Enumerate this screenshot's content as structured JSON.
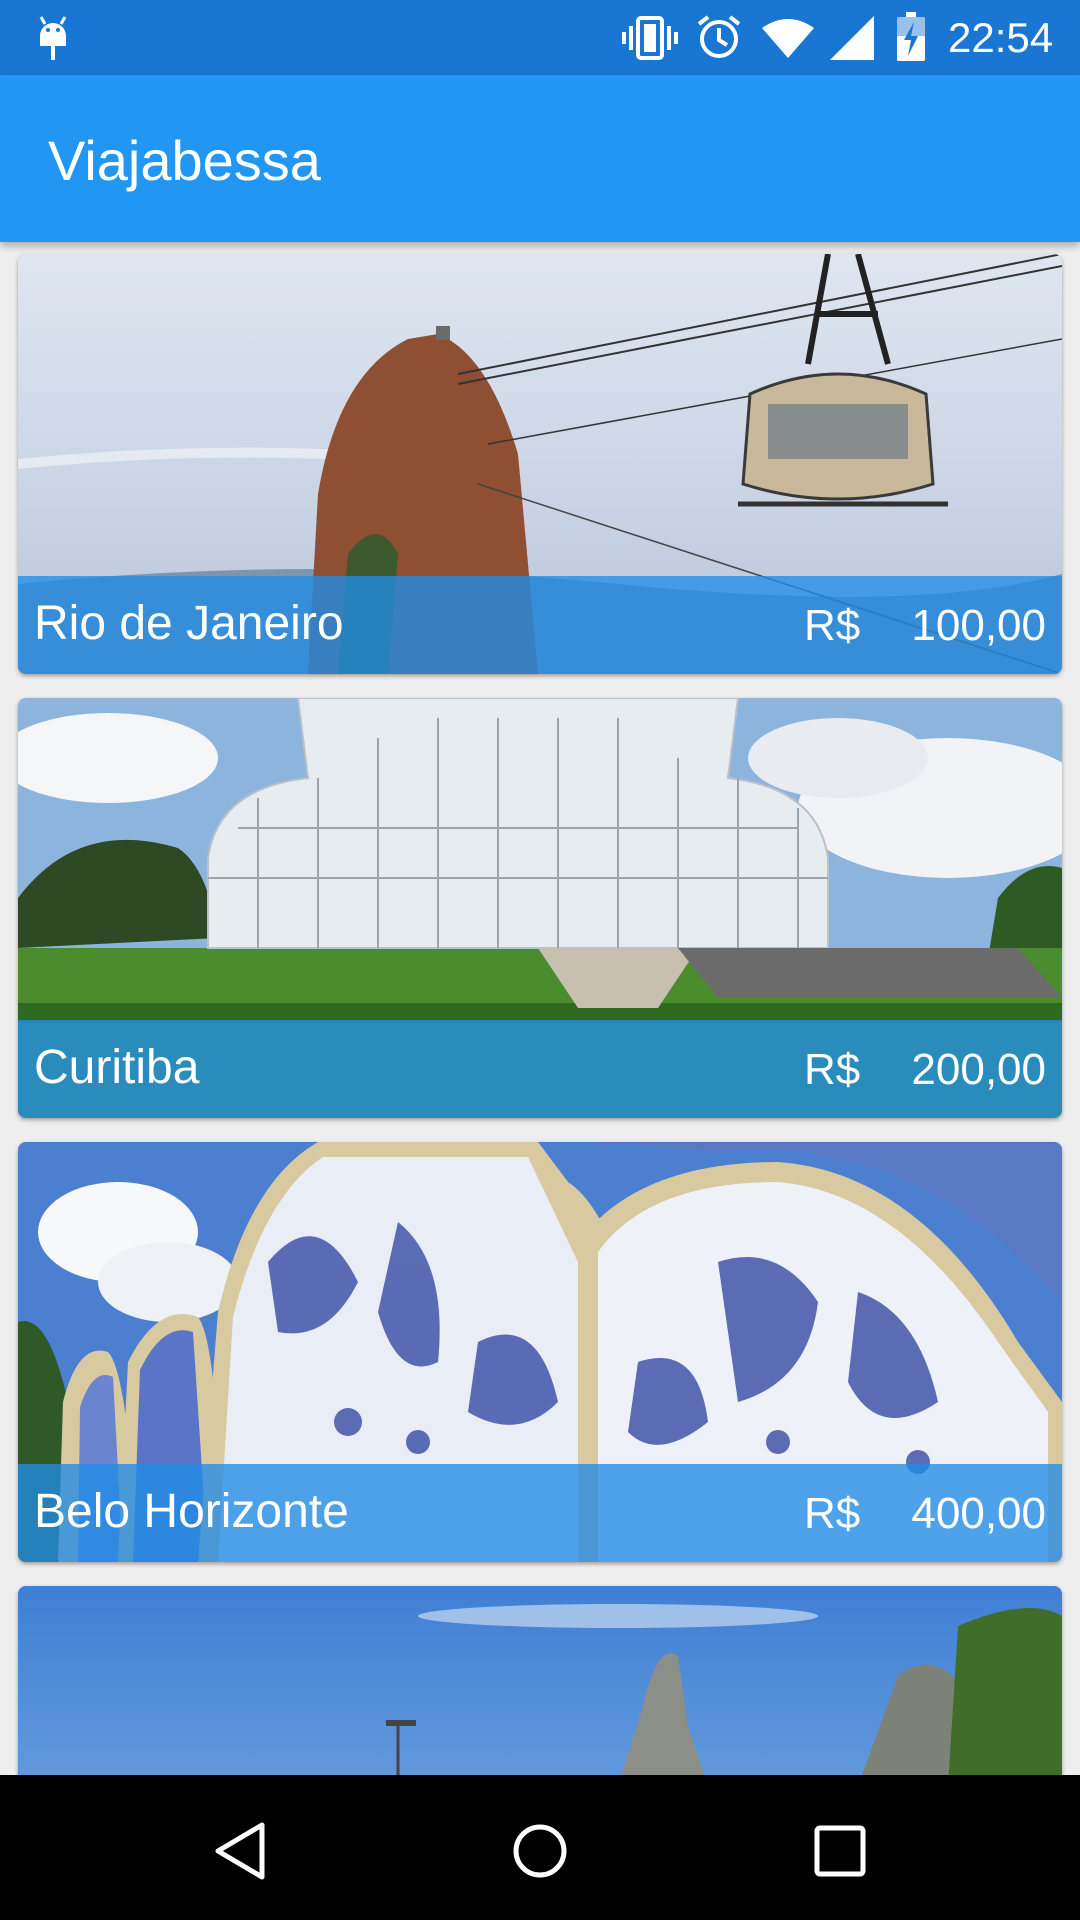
{
  "status_bar": {
    "time": "22:54",
    "icons": [
      "android-debug-icon",
      "vibrate-icon",
      "alarm-icon",
      "wifi-icon",
      "cell-signal-icon",
      "battery-charging-icon"
    ]
  },
  "app_bar": {
    "title": "Viajabessa"
  },
  "destinations": [
    {
      "city": "Rio de Janeiro",
      "currency": "R$",
      "price": "100,00",
      "image": "sugarloaf-cable-car-photo"
    },
    {
      "city": "Curitiba",
      "currency": "R$",
      "price": "200,00",
      "image": "botanical-garden-greenhouse-photo"
    },
    {
      "city": "Belo Horizonte",
      "currency": "R$",
      "price": "400,00",
      "image": "pampulha-church-tiles-photo"
    },
    {
      "city": "",
      "currency": "",
      "price": "",
      "image": "mountain-peaks-photo"
    }
  ],
  "nav_bar": {
    "icons": [
      "back-icon",
      "home-icon",
      "recents-icon"
    ]
  },
  "colors": {
    "status_bar": "#1976d2",
    "app_bar": "#2196f3",
    "caption_overlay": "#218ce6",
    "nav_bar": "#000000"
  }
}
